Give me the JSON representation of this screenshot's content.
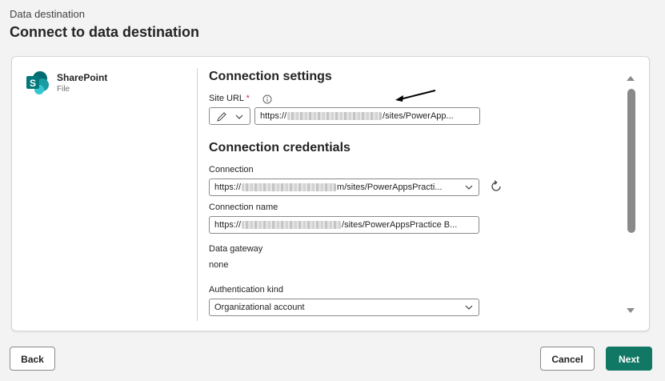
{
  "header": {
    "breadcrumb": "Data destination",
    "title": "Connect to data destination"
  },
  "connector": {
    "name": "SharePoint",
    "type": "File",
    "icon": "sharepoint-logo-icon"
  },
  "connection_settings": {
    "title": "Connection settings",
    "site_url_label": "Site URL",
    "required_marker": "*",
    "site_url_prefix": "https://",
    "site_url_suffix": "/sites/PowerApp..."
  },
  "connection_credentials": {
    "title": "Connection credentials",
    "connection_label": "Connection",
    "connection_prefix": "https://",
    "connection_suffix": "m/sites/PowerAppsPracti...",
    "connection_name_label": "Connection name",
    "connection_name_prefix": "https://",
    "connection_name_suffix": "/sites/PowerAppsPractice B...",
    "gateway_label": "Data gateway",
    "gateway_value": "none",
    "auth_label": "Authentication kind",
    "auth_value": "Organizational account"
  },
  "footer": {
    "back_label": "Back",
    "cancel_label": "Cancel",
    "next_label": "Next"
  },
  "colors": {
    "primary": "#117865",
    "sharepoint": "#036c70",
    "required": "#c4314b"
  }
}
